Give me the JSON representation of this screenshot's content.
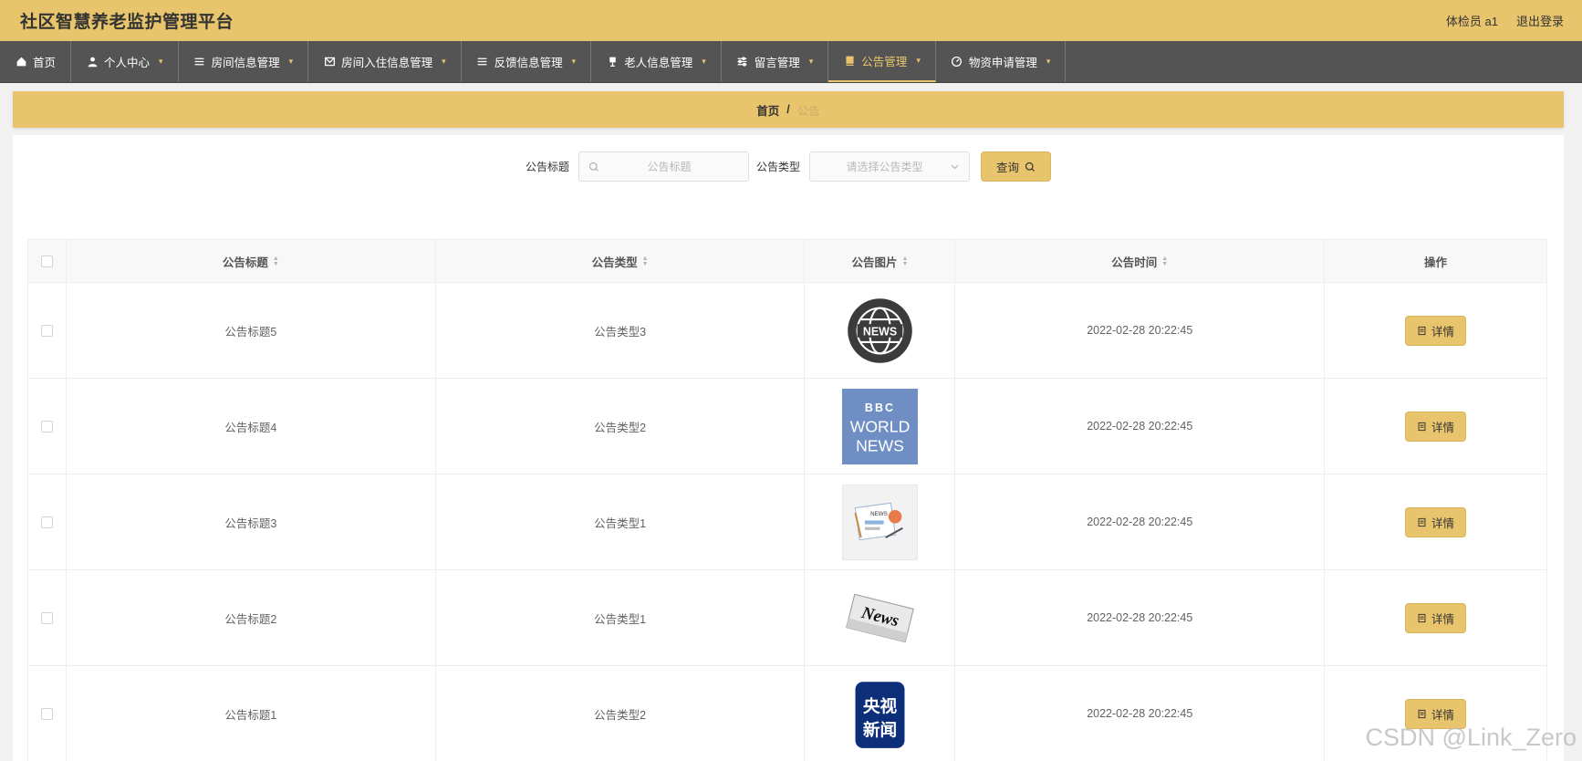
{
  "app": {
    "title": "社区智慧养老监护管理平台"
  },
  "header": {
    "user_label": "体检员 a1",
    "logout_label": "退出登录"
  },
  "nav": {
    "items": [
      {
        "label": "首页",
        "icon": "home-icon",
        "has_dropdown": false
      },
      {
        "label": "个人中心",
        "icon": "user-icon",
        "has_dropdown": true
      },
      {
        "label": "房间信息管理",
        "icon": "list-icon",
        "has_dropdown": true
      },
      {
        "label": "房间入住信息管理",
        "icon": "mail-icon",
        "has_dropdown": true
      },
      {
        "label": "反馈信息管理",
        "icon": "list-icon",
        "has_dropdown": true
      },
      {
        "label": "老人信息管理",
        "icon": "stamp-icon",
        "has_dropdown": true
      },
      {
        "label": "留言管理",
        "icon": "sliders-icon",
        "has_dropdown": true
      },
      {
        "label": "公告管理",
        "icon": "notice-icon",
        "has_dropdown": true,
        "active": true
      },
      {
        "label": "物资申请管理",
        "icon": "gauge-icon",
        "has_dropdown": true
      }
    ]
  },
  "breadcrumb": {
    "home": "首页",
    "separator": "/",
    "current": "公告"
  },
  "search": {
    "title_label": "公告标题",
    "title_placeholder": "公告标题",
    "type_label": "公告类型",
    "type_placeholder": "请选择公告类型",
    "query_label": "查询"
  },
  "table": {
    "headers": {
      "title": "公告标题",
      "type": "公告类型",
      "picture": "公告图片",
      "time": "公告时间",
      "operation": "操作"
    },
    "detail_label": "详情",
    "rows": [
      {
        "title": "公告标题5",
        "type": "公告类型3",
        "picture": "news-globe-image",
        "time": "2022-02-28 20:22:45",
        "pic_text": [
          "NEWS"
        ]
      },
      {
        "title": "公告标题4",
        "type": "公告类型2",
        "picture": "bbc-world-news-image",
        "time": "2022-02-28 20:22:45",
        "pic_text": [
          "BBC",
          "WORLD",
          "NEWS"
        ]
      },
      {
        "title": "公告标题3",
        "type": "公告类型1",
        "picture": "newspaper-illustration-image",
        "time": "2022-02-28 20:22:45",
        "pic_text": [
          "NEWS"
        ]
      },
      {
        "title": "公告标题2",
        "type": "公告类型1",
        "picture": "newspaper-roll-image",
        "time": "2022-02-28 20:22:45",
        "pic_text": [
          "News"
        ]
      },
      {
        "title": "公告标题1",
        "type": "公告类型2",
        "picture": "cctv-news-image",
        "time": "2022-02-28 20:22:45",
        "pic_text": [
          "央视",
          "新闻"
        ]
      }
    ]
  },
  "watermark": "CSDN @Link_Zero",
  "colors": {
    "accent": "#e8c46c",
    "nav_bg": "#545454",
    "page_bg": "#f1f1f1"
  }
}
